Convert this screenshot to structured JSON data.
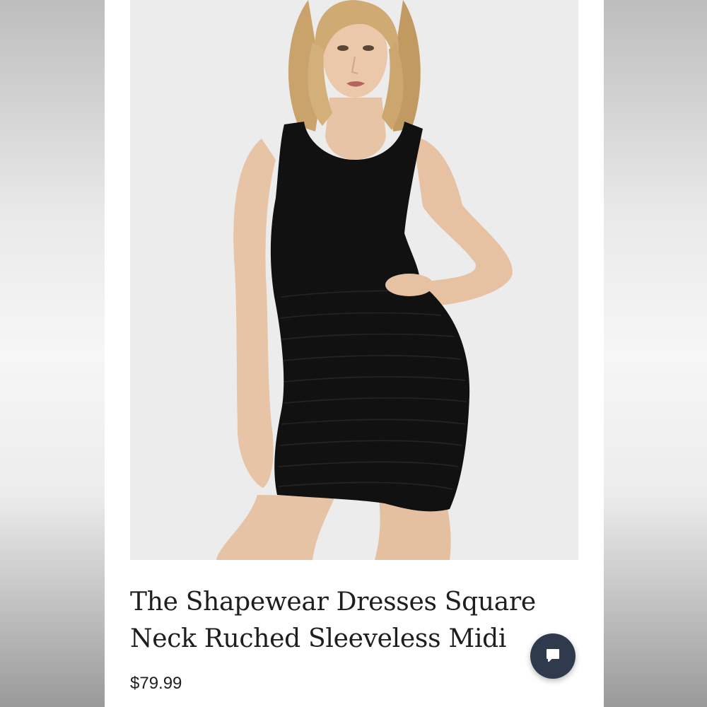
{
  "product": {
    "title": "The Shapewear Dresses Square Neck Ruched Sleeveless Midi",
    "price": "$79.99",
    "image_alt": "model wearing black ruched sleeveless dress"
  },
  "chat": {
    "icon": "chat-bubble-icon"
  },
  "colors": {
    "page_background": "#ffffff",
    "photo_background": "#ececed",
    "dress": "#111111",
    "chat_button": "#2f3b4c",
    "text": "#1e1e1e"
  }
}
